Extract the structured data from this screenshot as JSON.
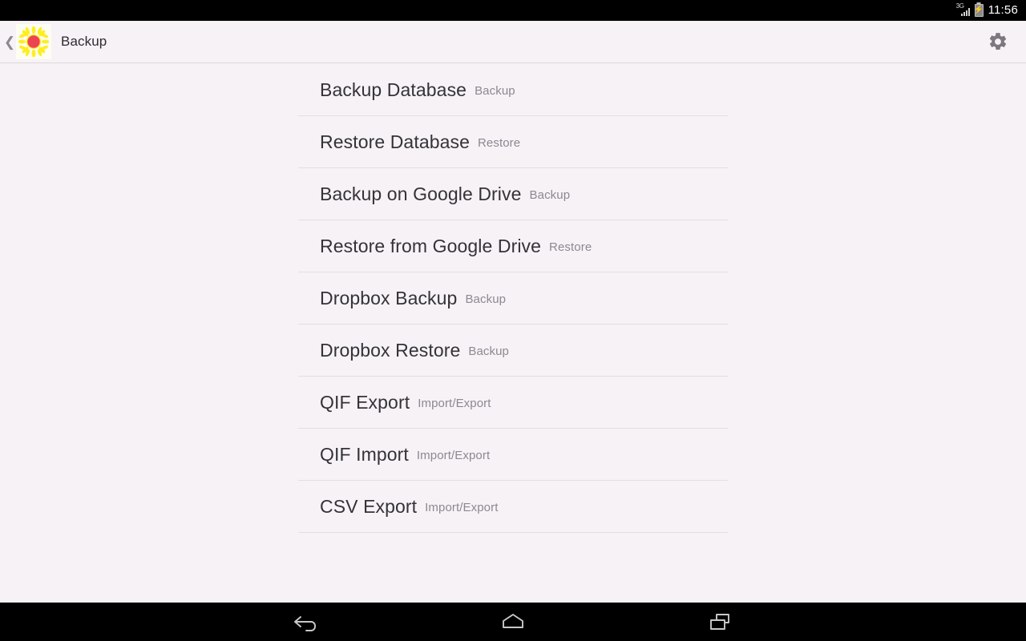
{
  "status_bar": {
    "network_label": "3G",
    "signal_icon": "signal-bars-icon",
    "battery_icon": "battery-charging-icon",
    "time": "11:56"
  },
  "action_bar": {
    "back_icon": "back-chevron-icon",
    "app_icon": "sunflower-app-icon",
    "title": "Backup",
    "settings_icon": "gear-icon",
    "colors": {
      "background": "#f7f2f6",
      "petal": "#ffee1f",
      "center": "#ec4453",
      "title_text": "#2c2c31"
    }
  },
  "list": {
    "rows": [
      {
        "title": "Backup Database",
        "category": "Backup"
      },
      {
        "title": "Restore Database",
        "category": "Restore"
      },
      {
        "title": "Backup on Google Drive",
        "category": "Backup"
      },
      {
        "title": "Restore from Google Drive",
        "category": "Restore"
      },
      {
        "title": "Dropbox Backup",
        "category": "Backup"
      },
      {
        "title": "Dropbox Restore",
        "category": "Backup"
      },
      {
        "title": "QIF Export",
        "category": "Import/Export"
      },
      {
        "title": "QIF Import",
        "category": "Import/Export"
      },
      {
        "title": "CSV Export",
        "category": "Import/Export"
      }
    ]
  },
  "nav_bar": {
    "back_label": "Back",
    "home_label": "Home",
    "recents_label": "Recent apps"
  }
}
